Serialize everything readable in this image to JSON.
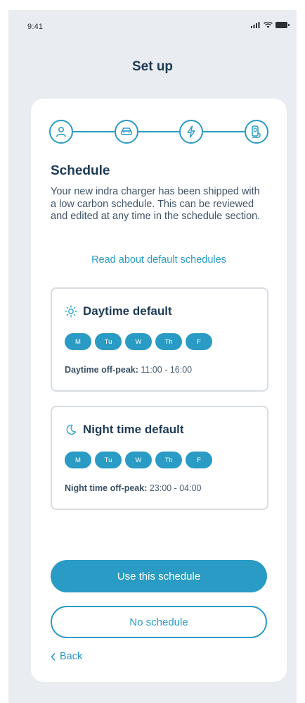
{
  "status_bar": {
    "time": "9:41"
  },
  "header": {
    "title": "Set up"
  },
  "stepper": {
    "steps": [
      {
        "icon": "person-icon"
      },
      {
        "icon": "car-icon"
      },
      {
        "icon": "lightning-icon"
      },
      {
        "icon": "charger-icon"
      }
    ]
  },
  "content": {
    "heading": "Schedule",
    "description": "Your new indra charger has been shipped with a low carbon schedule. This can be reviewed and edited at any time in the schedule section.",
    "link_label": "Read about default schedules"
  },
  "schedules": [
    {
      "icon": "sun-icon",
      "title": "Daytime default",
      "days": [
        "M",
        "Tu",
        "W",
        "Th",
        "F"
      ],
      "offpeak_label": "Daytime off-peak:",
      "offpeak_value": "11:00 - 16:00"
    },
    {
      "icon": "moon-icon",
      "title": "Night time default",
      "days": [
        "M",
        "Tu",
        "W",
        "Th",
        "F"
      ],
      "offpeak_label": "Night time off-peak:",
      "offpeak_value": "23:00 - 04:00"
    }
  ],
  "actions": {
    "primary_label": "Use this schedule",
    "secondary_label": "No schedule",
    "back_label": "Back"
  },
  "colors": {
    "accent": "#2a9bc4",
    "heading": "#1d3a55",
    "background": "#e9edf1",
    "card": "#ffffff",
    "border": "#d7dde2"
  }
}
